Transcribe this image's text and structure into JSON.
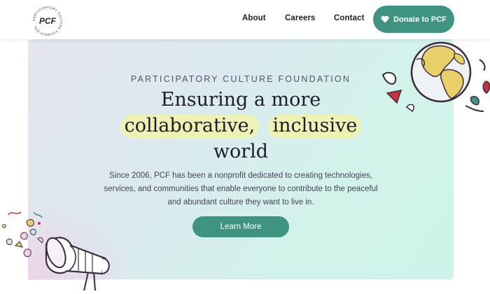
{
  "header": {
    "logo_text": "PCF",
    "logo_ring_text": "PARTICIPATORY CULTURE FOUNDATION",
    "nav": [
      {
        "label": "About"
      },
      {
        "label": "Careers"
      },
      {
        "label": "Contact"
      }
    ],
    "donate_label": "Donate to PCF",
    "donate_icon": "heart-icon"
  },
  "hero": {
    "eyebrow": "PARTICIPATORY CULTURE FOUNDATION",
    "headline_line1": "Ensuring a more",
    "headline_hl1": "collaborative,",
    "headline_hl2": "inclusive",
    "headline_line3": "world",
    "intro_line1": "Since 2006, PCF has been a nonprofit dedicated to creating technologies,",
    "intro_line2": "services, and communities that enable everyone to contribute to the peaceful",
    "intro_line3": "and abundant culture they want to live in.",
    "cta_label": "Learn More",
    "illustrations": [
      "globe-illustration",
      "megaphone-illustration"
    ]
  },
  "colors": {
    "accent": "#3e9481",
    "highlight": "#eef2b2",
    "text": "#1f1b2e"
  }
}
